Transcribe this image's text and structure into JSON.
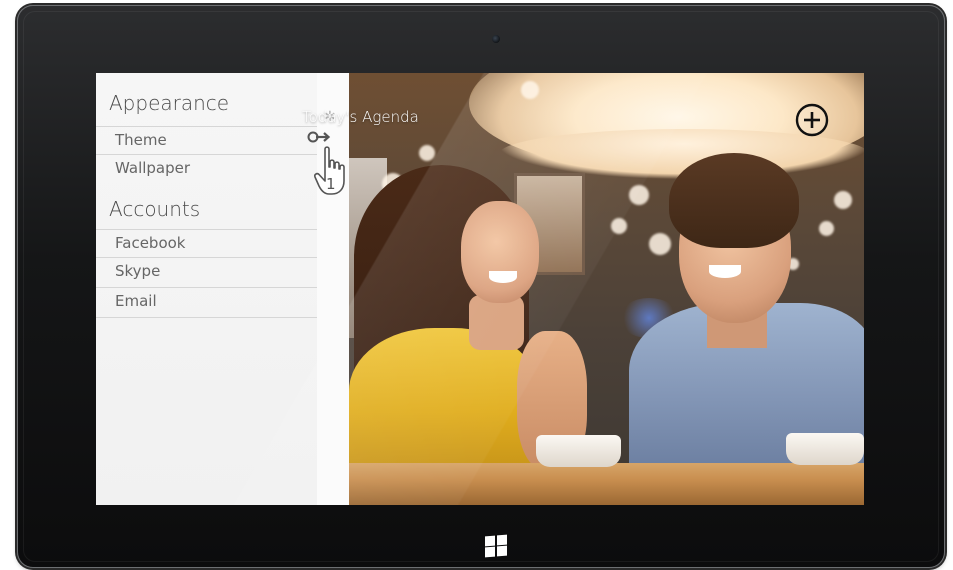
{
  "settings_panel": {
    "sections": [
      {
        "title": "Appearance",
        "items": [
          {
            "label": "Theme"
          },
          {
            "label": "Wallpaper"
          }
        ]
      },
      {
        "title": "Accounts",
        "items": [
          {
            "label": "Facebook"
          },
          {
            "label": "Skype"
          },
          {
            "label": "Email"
          }
        ]
      }
    ],
    "gear_icon": "gear-icon",
    "gesture_hint": {
      "icons": [
        "resize-arrow-icon",
        "hand-pointer-icon"
      ],
      "finger_count": "1"
    }
  },
  "main": {
    "title": "Today's Agenda",
    "add_button_icon": "plus-circle-icon"
  },
  "device": {
    "camera_icon": "camera-icon",
    "windows_button_icon": "windows-logo-icon"
  }
}
